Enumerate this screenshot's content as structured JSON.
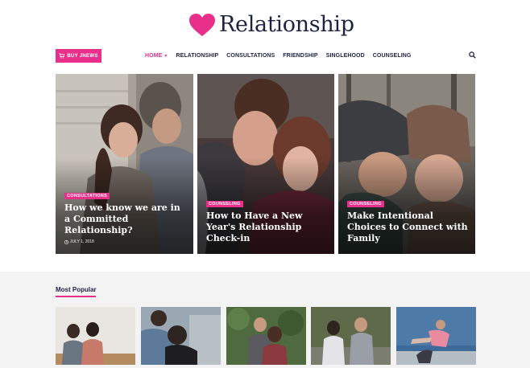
{
  "site": {
    "name": "Relationship"
  },
  "navbar": {
    "buy_label": "BUY JNEWS",
    "items": [
      {
        "label": "HOME"
      },
      {
        "label": "RELATIONSHIP"
      },
      {
        "label": "CONSULTATIONS"
      },
      {
        "label": "FRIENDSHIP"
      },
      {
        "label": "SINGLEHOOD"
      },
      {
        "label": "COUNSELING"
      }
    ]
  },
  "featured": [
    {
      "category": "CONSULTATIONS",
      "title": "How we know we are in a Committed Relationship?",
      "date": "JULY 1, 2018"
    },
    {
      "category": "COUNSELING",
      "title": "How to Have a New Year's Relationship Check-in"
    },
    {
      "category": "COUNSELING",
      "title": "Make Intentional Choices to Connect with Family"
    }
  ],
  "popular": {
    "heading": "Most Popular"
  },
  "colors": {
    "accent": "#e8308a",
    "navy": "#1d2241"
  }
}
